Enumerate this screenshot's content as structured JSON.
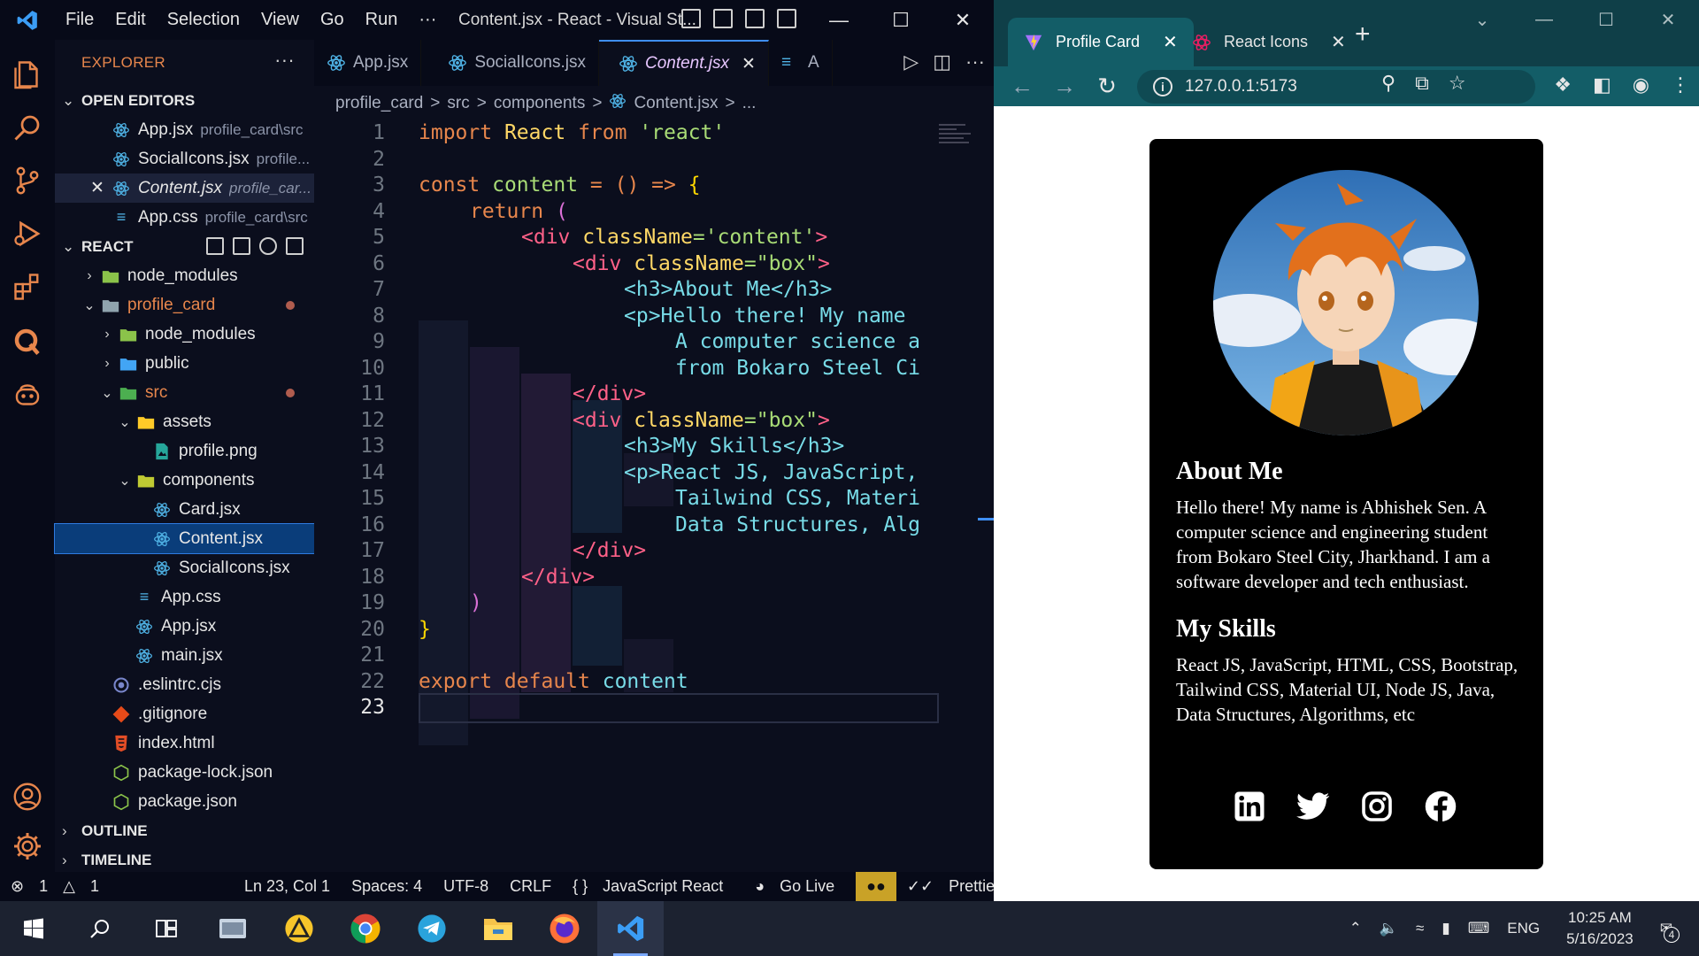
{
  "vscode": {
    "menu": [
      "File",
      "Edit",
      "Selection",
      "View",
      "Go",
      "Run",
      "···"
    ],
    "window_title": "Content.jsx - React - Visual St...",
    "explorer_label": "EXPLORER",
    "open_editors_label": "OPEN EDITORS",
    "open_editors": [
      {
        "name": "App.jsx",
        "desc": "profile_card\\src"
      },
      {
        "name": "SocialIcons.jsx",
        "desc": "profile..."
      },
      {
        "name": "Content.jsx",
        "desc": "profile_car..."
      },
      {
        "name": "App.css",
        "desc": "profile_card\\src"
      }
    ],
    "workspace_label": "REACT",
    "tree": [
      {
        "name": "node_modules"
      },
      {
        "name": "profile_card"
      },
      {
        "name": "node_modules"
      },
      {
        "name": "public"
      },
      {
        "name": "src"
      },
      {
        "name": "assets"
      },
      {
        "name": "profile.png"
      },
      {
        "name": "components"
      },
      {
        "name": "Card.jsx"
      },
      {
        "name": "Content.jsx"
      },
      {
        "name": "SocialIcons.jsx"
      },
      {
        "name": "App.css"
      },
      {
        "name": "App.jsx"
      },
      {
        "name": "main.jsx"
      },
      {
        "name": ".eslintrc.cjs"
      },
      {
        "name": ".gitignore"
      },
      {
        "name": "index.html"
      },
      {
        "name": "package-lock.json"
      },
      {
        "name": "package.json"
      }
    ],
    "outline_label": "OUTLINE",
    "timeline_label": "TIMELINE",
    "tabs": [
      "App.jsx",
      "SocialIcons.jsx",
      "Content.jsx",
      "A"
    ],
    "breadcrumb": [
      "profile_card",
      ">",
      "src",
      ">",
      "components",
      ">",
      "Content.jsx",
      ">",
      "..."
    ],
    "code_lines": [
      "1",
      "2",
      "3",
      "4",
      "5",
      "6",
      "7",
      "8",
      "9",
      "10",
      "11",
      "12",
      "13",
      "14",
      "15",
      "16",
      "17",
      "18",
      "19",
      "20",
      "21",
      "22",
      "23"
    ],
    "code": {
      "l1_import": "import",
      "l1_react": "React",
      "l1_from": "from",
      "l1_str": "'react'",
      "l3_const": "const",
      "l3_name": "content",
      "l3_rest": "= () =>",
      "l3_brace": "{",
      "l4_return": "return",
      "l4_paren": "(",
      "l5_open": "<div",
      "l5_attr": "className",
      "l5_val": "='content'",
      "l5_close": ">",
      "l6_open": "<div",
      "l6_attr": "className",
      "l6_val": "=\"box\"",
      "l6_close": ">",
      "l7_text": "<h3>About Me</h3>",
      "l8_text": "<p>Hello there! My name",
      "l9_text": "A computer science a",
      "l10_text": "from Bokaro Steel Ci",
      "l11_text": "</div>",
      "l12_open": "<div",
      "l12_attr": "className",
      "l12_val": "=\"box\"",
      "l12_close": ">",
      "l13_text": "<h3>My Skills</h3>",
      "l14_text": "<p>React JS, JavaScript,",
      "l15_text": "Tailwind CSS, Materi",
      "l16_text": "Data Structures, Alg",
      "l17_text": "</div>",
      "l18_text": "</div>",
      "l19_text": ")",
      "l20_text": "}",
      "l22_export": "export default",
      "l22_name": "content"
    },
    "status": {
      "errors": "1",
      "warnings": "1",
      "position": "Ln 23, Col 1",
      "spaces": "Spaces: 4",
      "encoding": "UTF-8",
      "eol": "CRLF",
      "language": "JavaScript React",
      "golive": "Go Live",
      "prettier": "Prettier"
    }
  },
  "browser": {
    "tabs": [
      {
        "title": "Profile Card",
        "active": true
      },
      {
        "title": "React Icons",
        "active": false
      }
    ],
    "url": "127.0.0.1:5173",
    "card": {
      "about_title": "About Me",
      "about_text": "Hello there! My name is Abhishek Sen. A computer science and engineering student from Bokaro Steel City, Jharkhand. I am a software developer and tech enthusiast.",
      "skills_title": "My Skills",
      "skills_text": "React JS, JavaScript, HTML, CSS, Bootstrap, Tailwind CSS, Material UI, Node JS, Java, Data Structures, Algorithms, etc",
      "socials": [
        "linkedin-icon",
        "twitter-icon",
        "instagram-icon",
        "facebook-icon"
      ]
    }
  },
  "taskbar": {
    "lang": "ENG",
    "time": "10:25 AM",
    "date": "5/16/2023",
    "notif_count": "4"
  },
  "colors": {
    "accent": "#3f8ff7",
    "browser_frame": "#135d67",
    "card_bg": "#000000"
  }
}
